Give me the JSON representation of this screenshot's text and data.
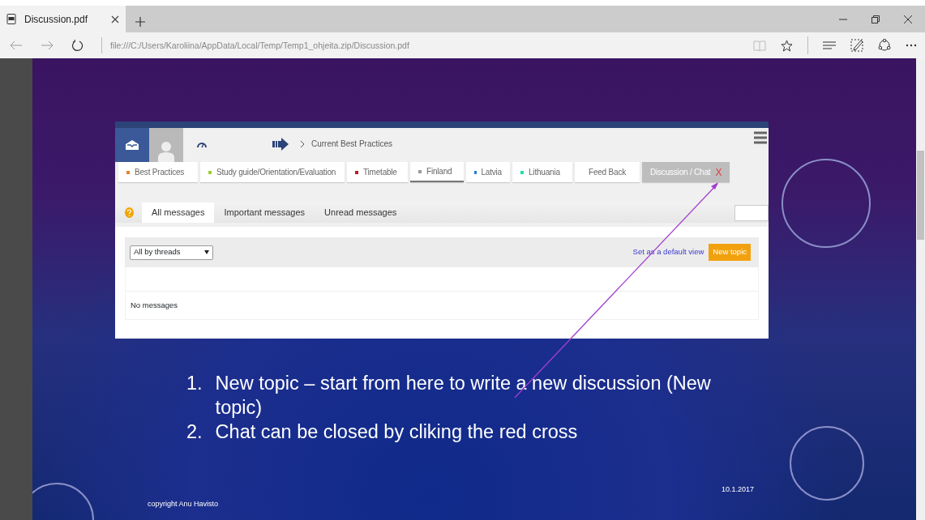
{
  "browser": {
    "tab_title": "Discussion.pdf",
    "address": "file:///C:/Users/Karoliina/AppData/Local/Temp/Temp1_ohjeita.zip/Discussion.pdf"
  },
  "slide": {
    "screenshot": {
      "breadcrumb": "Current Best Practices",
      "menu_tabs": [
        {
          "label": "Best Practices",
          "color": "#e8822a",
          "selected": false,
          "underlined": false
        },
        {
          "label": "Study guide/Orientation/Evaluation",
          "color": "#9ad22e",
          "selected": false,
          "underlined": false
        },
        {
          "label": "Timetable",
          "color": "#c0182a",
          "selected": false,
          "underlined": false
        },
        {
          "label": "Finland",
          "color": "#9a9a9a",
          "selected": false,
          "underlined": true
        },
        {
          "label": "Latvia",
          "color": "#2b7bd1",
          "selected": false,
          "underlined": false
        },
        {
          "label": "Lithuania",
          "color": "#22dca8",
          "selected": false,
          "underlined": false
        },
        {
          "label": "Feed Back",
          "selected": false,
          "underlined": false
        },
        {
          "label": "Discussion / Chat",
          "selected": true,
          "underlined": false,
          "close": "X"
        }
      ],
      "message_tabs": [
        {
          "label": "All messages",
          "selected": true
        },
        {
          "label": "Important messages",
          "selected": false
        },
        {
          "label": "Unread messages",
          "selected": false
        }
      ],
      "filter": "All by threads",
      "default_link": "Set as a default view",
      "new_topic": "New topic",
      "empty": "No messages"
    },
    "steps": [
      {
        "number": "1.",
        "text": "New topic – start from here to write a new discussion (New topic)"
      },
      {
        "number": "2.",
        "text": "Chat can be closed by cliking the red cross"
      }
    ],
    "copyright": "copyright Anu Havisto",
    "date": "10.1.2017"
  }
}
